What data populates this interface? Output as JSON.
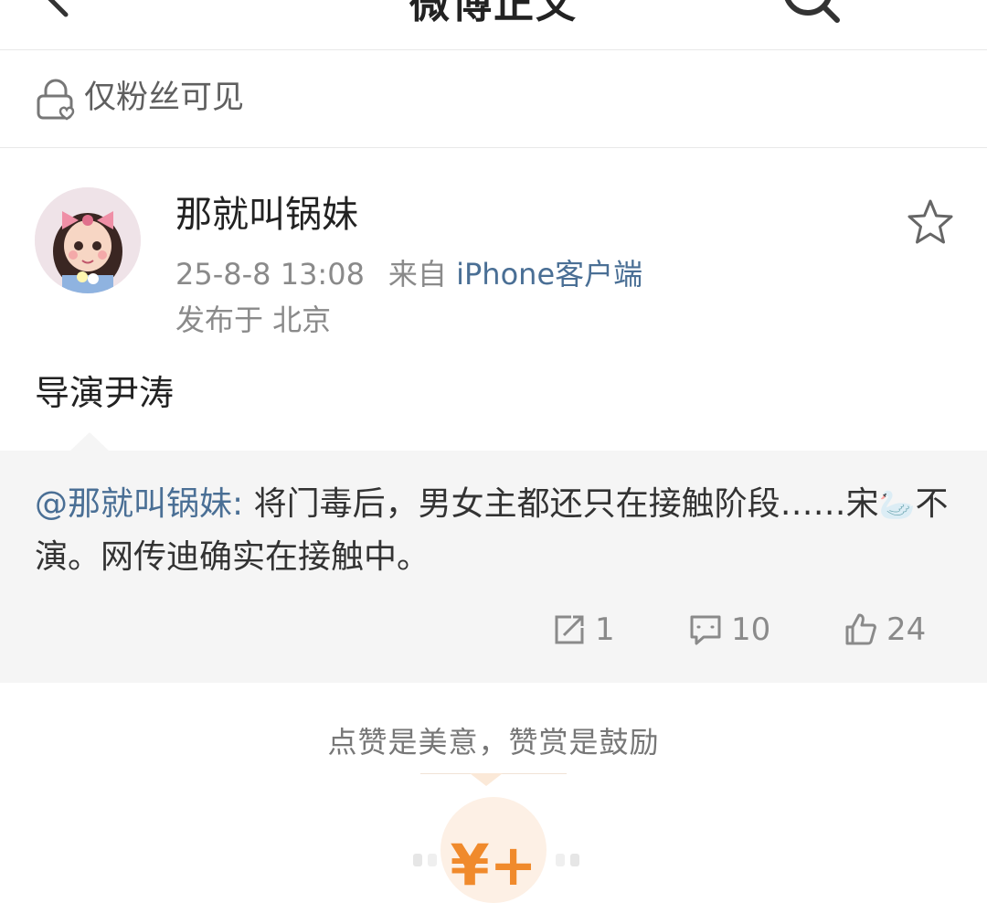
{
  "header": {
    "title": "微博正文"
  },
  "visibility": {
    "label": "仅粉丝可见"
  },
  "post": {
    "author": "那就叫锅妹",
    "date": "25-8-8 13:08",
    "source_prefix": "来自",
    "source": "iPhone客户端",
    "location": "发布于 北京",
    "text": "导演尹涛"
  },
  "repost": {
    "mention": "@那就叫锅妹",
    "separator": ":",
    "text_part1": " 将门毒后，男女主都还只在接触阶段……宋",
    "swan_glyph": "🦢",
    "text_part2": "不演。网传迪确实在接触中。",
    "actions": {
      "repost_count": "1",
      "comment_count": "10",
      "like_count": "24"
    }
  },
  "reward": {
    "slogan": "点赞是美意，赞赏是鼓励",
    "button_symbol": "¥+"
  },
  "colors": {
    "link": "#4a6f95",
    "reward_orange": "#f08a2c",
    "repost_bg": "#f5f5f5"
  }
}
